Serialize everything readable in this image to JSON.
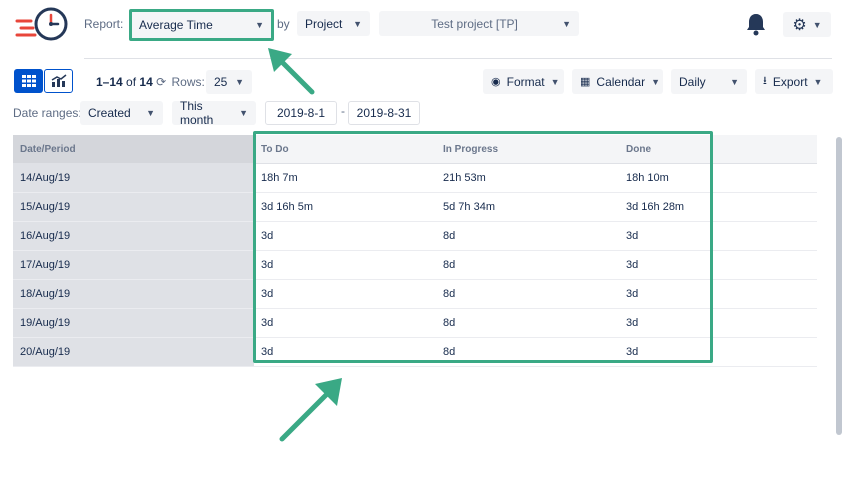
{
  "header": {
    "report_label": "Report:",
    "report_value": "Average Time",
    "by_label": "by",
    "group_value": "Project",
    "project_value": "Test project [TP]"
  },
  "toolbar": {
    "range_text": "1–14",
    "of_text": "of",
    "total": "14",
    "rows_label": "Rows:",
    "rows_value": "25",
    "format_label": "Format",
    "calendar_label": "Calendar",
    "period_value": "Daily",
    "export_label": "Export"
  },
  "filters": {
    "date_ranges_label": "Date ranges:",
    "field_value": "Created",
    "preset_value": "This month",
    "start_date": "2019-8-1",
    "separator": "-",
    "end_date": "2019-8-31"
  },
  "table": {
    "columns": [
      "Date/Period",
      "To Do",
      "In Progress",
      "Done"
    ],
    "rows": [
      [
        "14/Aug/19",
        "18h 7m",
        "21h 53m",
        "18h 10m"
      ],
      [
        "15/Aug/19",
        "3d 16h 5m",
        "5d 7h 34m",
        "3d 16h 28m"
      ],
      [
        "16/Aug/19",
        "3d",
        "8d",
        "3d"
      ],
      [
        "17/Aug/19",
        "3d",
        "8d",
        "3d"
      ],
      [
        "18/Aug/19",
        "3d",
        "8d",
        "3d"
      ],
      [
        "19/Aug/19",
        "3d",
        "8d",
        "3d"
      ],
      [
        "20/Aug/19",
        "3d",
        "8d",
        "3d"
      ]
    ]
  },
  "colors": {
    "highlight": "#3aa985",
    "accent_blue": "#0052cc"
  },
  "icons": [
    "app-logo-icon",
    "bell-icon",
    "gear-icon",
    "grid-view-icon",
    "chart-view-icon",
    "refresh-icon",
    "eye-icon",
    "calendar-icon",
    "download-icon",
    "arrow-annotation-icon"
  ]
}
